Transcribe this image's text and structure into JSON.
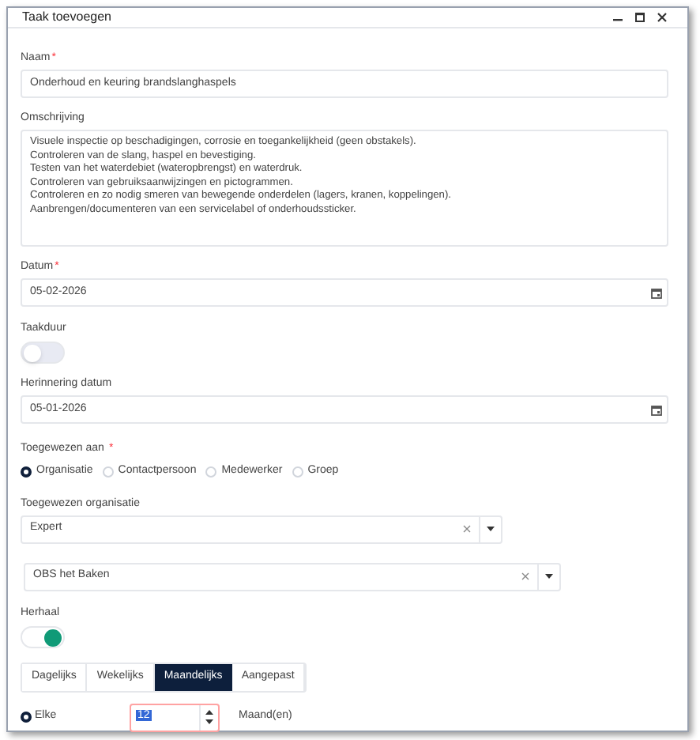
{
  "window": {
    "title": "Taak toevoegen"
  },
  "name_field": {
    "label": "Naam",
    "required_mark": "*",
    "value": "Onderhoud en keuring brandslanghaspels"
  },
  "description": {
    "label": "Omschrijving",
    "lines": [
      "Visuele inspectie op beschadigingen, corrosie en toegankelijkheid (geen obstakels).",
      "Controleren van de slang, haspel en bevestiging.",
      "Testen van het waterdebiet (wateropbrengst) en waterdruk.",
      "Controleren van gebruiksaanwijzingen en pictogrammen.",
      "Controleren en zo nodig smeren van bewegende onderdelen (lagers, kranen, koppelingen).",
      "Aanbrengen/documenteren van een servicelabel of onderhoudssticker."
    ]
  },
  "date": {
    "label": "Datum",
    "required_mark": "*",
    "value": "05-02-2026"
  },
  "duration": {
    "label": "Taakduur",
    "on": false
  },
  "reminder": {
    "label": "Herinnering datum",
    "value": "05-01-2026"
  },
  "assigned_to": {
    "label": "Toegewezen aan",
    "required_mark": "*",
    "options": [
      {
        "label": "Organisatie",
        "selected": true
      },
      {
        "label": "Contactpersoon",
        "selected": false
      },
      {
        "label": "Medewerker",
        "selected": false
      },
      {
        "label": "Groep",
        "selected": false
      }
    ]
  },
  "organization": {
    "label": "Toegewezen organisatie",
    "value": "Expert"
  },
  "location": {
    "value": "OBS het Baken"
  },
  "repeat": {
    "label": "Herhaal",
    "on": true
  },
  "frequency_tabs": [
    {
      "label": "Dagelijks",
      "selected": false
    },
    {
      "label": "Wekelijks",
      "selected": false
    },
    {
      "label": "Maandelijks",
      "selected": true
    },
    {
      "label": "Aangepast",
      "selected": false
    }
  ],
  "interval": {
    "option": {
      "label": "Elke",
      "selected": true
    },
    "value": "12",
    "unit": "Maand(en)"
  }
}
